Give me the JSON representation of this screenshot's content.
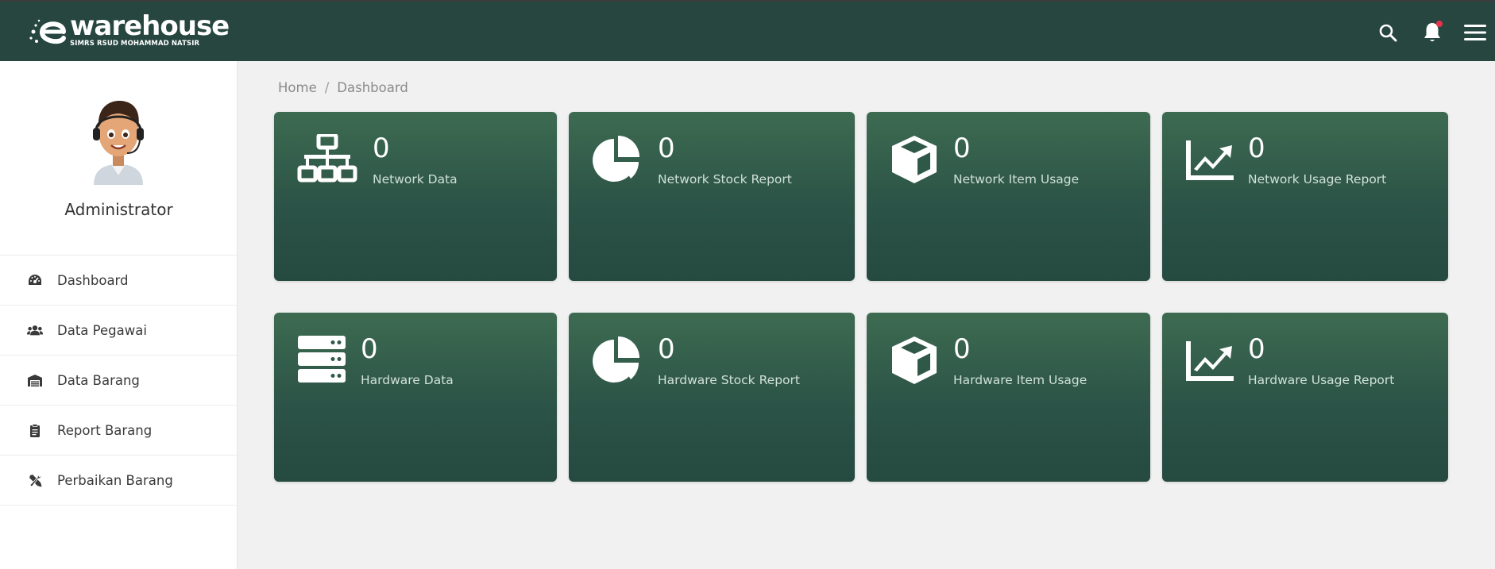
{
  "header": {
    "logo_word": "warehouse",
    "logo_subtitle": "SIMRS RSUD MOHAMMAD NATSIR",
    "icons": [
      "search-icon",
      "bell-icon",
      "hamburger-menu-icon"
    ],
    "notification_dot_color": "#e8334a",
    "background": "#26463f"
  },
  "sidebar": {
    "profile_name": "Administrator",
    "items": [
      {
        "label": "Dashboard",
        "icon": "gauge-icon"
      },
      {
        "label": "Data Pegawai",
        "icon": "users-icon"
      },
      {
        "label": "Data Barang",
        "icon": "warehouse-icon"
      },
      {
        "label": "Report Barang",
        "icon": "clipboard-icon"
      },
      {
        "label": "Perbaikan Barang",
        "icon": "tools-icon"
      }
    ]
  },
  "breadcrumb": {
    "home": "Home",
    "separator": "/",
    "current": "Dashboard"
  },
  "cards": [
    {
      "value": "0",
      "label": "Network Data",
      "icon": "network-icon"
    },
    {
      "value": "0",
      "label": "Network Stock Report",
      "icon": "pie-chart-icon"
    },
    {
      "value": "0",
      "label": "Network Item Usage",
      "icon": "cube-icon"
    },
    {
      "value": "0",
      "label": "Network Usage Report",
      "icon": "line-chart-icon"
    },
    {
      "value": "0",
      "label": "Hardware Data",
      "icon": "server-icon"
    },
    {
      "value": "0",
      "label": "Hardware Stock Report",
      "icon": "pie-chart-icon"
    },
    {
      "value": "0",
      "label": "Hardware Item Usage",
      "icon": "cube-icon"
    },
    {
      "value": "0",
      "label": "Hardware Usage Report",
      "icon": "line-chart-icon"
    }
  ],
  "colors": {
    "accent": "#26463f",
    "card_top": "#3d6b51",
    "card_bottom": "#254a40"
  }
}
